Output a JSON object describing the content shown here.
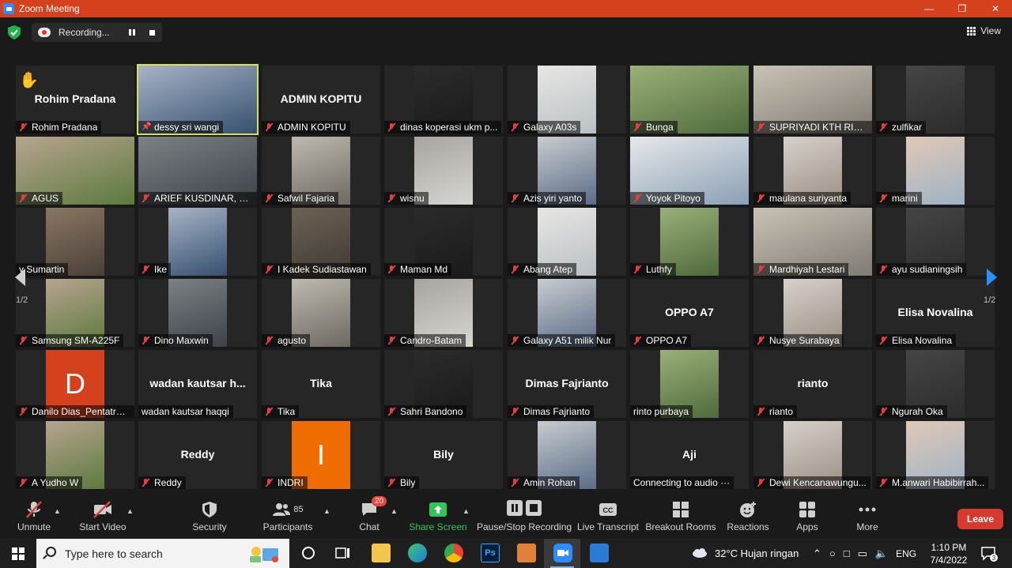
{
  "window": {
    "title": "Zoom Meeting"
  },
  "topbar": {
    "recording_text": "Recording...",
    "view_label": "View"
  },
  "gallery": {
    "page_indicator_left": "1/2",
    "page_indicator_right": "1/2",
    "tiles": [
      {
        "name": "Rohim Pradana",
        "big_name": "Rohim Pradana",
        "muted": true,
        "hand_raised": true
      },
      {
        "name": "dessy sri wangi",
        "muted": false,
        "active": true
      },
      {
        "name": "ADMIN KOPITU",
        "big_name": "ADMIN KOPITU",
        "muted": true
      },
      {
        "name": "dinas koperasi ukm p...",
        "muted": true
      },
      {
        "name": "Galaxy A03s",
        "muted": true
      },
      {
        "name": "Bunga",
        "muted": true
      },
      {
        "name": "SUPRIYADI KTH RIMB...",
        "muted": true
      },
      {
        "name": "zulfikar",
        "muted": true
      },
      {
        "name": "AGUS",
        "muted": true
      },
      {
        "name": "ARIEF KUSDINAR, S.S...",
        "muted": true
      },
      {
        "name": "Safwil Fajaria",
        "muted": true
      },
      {
        "name": "wisnu",
        "muted": true
      },
      {
        "name": "Azis yiri yanto",
        "muted": true
      },
      {
        "name": "Yoyok Pitoyo",
        "muted": true
      },
      {
        "name": "maulana suriyanta",
        "muted": true
      },
      {
        "name": "marini",
        "muted": true
      },
      {
        "name": "y Sumartin",
        "muted": false
      },
      {
        "name": "Ike",
        "muted": true
      },
      {
        "name": "I Kadek Sudiastawan",
        "muted": true
      },
      {
        "name": "Maman Md",
        "muted": true
      },
      {
        "name": "Abang Atep",
        "muted": true
      },
      {
        "name": "Luthfy",
        "muted": true
      },
      {
        "name": "Mardhiyah Lestari",
        "muted": true
      },
      {
        "name": "ayu sudianingsih",
        "muted": true
      },
      {
        "name": "Samsung SM-A225F",
        "muted": true
      },
      {
        "name": "Dino Maxwin",
        "muted": true
      },
      {
        "name": "agusto",
        "muted": true
      },
      {
        "name": "Candro-Batam",
        "muted": true
      },
      {
        "name": "Galaxy A51 milik Nur",
        "muted": true
      },
      {
        "name": "OPPO A7",
        "big_name": "OPPO A7",
        "muted": true
      },
      {
        "name": "Nusye Surabaya",
        "muted": true
      },
      {
        "name": "Elisa Novalina",
        "big_name": "Elisa Novalina",
        "muted": true
      },
      {
        "name": "Danilo Dias_Pentatrans",
        "avatar_letter": "D",
        "muted": true
      },
      {
        "name": "wadan kautsar haqqi",
        "big_name": "wadan kautsar h...",
        "muted": false
      },
      {
        "name": "Tika",
        "big_name": "Tika",
        "muted": true
      },
      {
        "name": "Sahri Bandono",
        "muted": true
      },
      {
        "name": "Dimas Fajrianto",
        "big_name": "Dimas Fajrianto",
        "muted": true
      },
      {
        "name": "rinto purbaya",
        "muted": false
      },
      {
        "name": "rianto",
        "big_name": "rianto",
        "muted": true
      },
      {
        "name": "Ngurah Oka",
        "muted": true
      },
      {
        "name": "A Yudho W",
        "muted": true
      },
      {
        "name": "Reddy",
        "big_name": "Reddy",
        "muted": true
      },
      {
        "name": "INDRI",
        "avatar_letter": "I",
        "muted": true
      },
      {
        "name": "Bily",
        "big_name": "Bily",
        "muted": true
      },
      {
        "name": "Amin Rohan",
        "muted": true
      },
      {
        "name": "Connecting to audio ···",
        "big_name": "Aji",
        "muted": false
      },
      {
        "name": "Dewi Kencanawungu...",
        "muted": true
      },
      {
        "name": "M.anwari Habibirrah...",
        "muted": true
      }
    ]
  },
  "toolbar": {
    "unmute": "Unmute",
    "start_video": "Start Video",
    "security": "Security",
    "participants": "Participants",
    "participants_count": "85",
    "chat": "Chat",
    "chat_badge": "20",
    "share_screen": "Share Screen",
    "pause_stop_recording": "Pause/Stop Recording",
    "live_transcript": "Live Transcript",
    "live_transcript_icon_text": "CC",
    "breakout_rooms": "Breakout Rooms",
    "reactions": "Reactions",
    "apps": "Apps",
    "more": "More",
    "leave": "Leave"
  },
  "taskbar": {
    "search_placeholder": "Type here to search",
    "weather": "32°C  Hujan ringan",
    "language": "ENG",
    "time": "1:10 PM",
    "date": "7/4/2022",
    "notification_count": "3",
    "photoshop_label": "Ps"
  },
  "colors": {
    "titlebar": "#d4411c",
    "active_speaker": "#d8e04a",
    "share_green": "#2fc75a",
    "leave_red": "#d63a2f"
  }
}
